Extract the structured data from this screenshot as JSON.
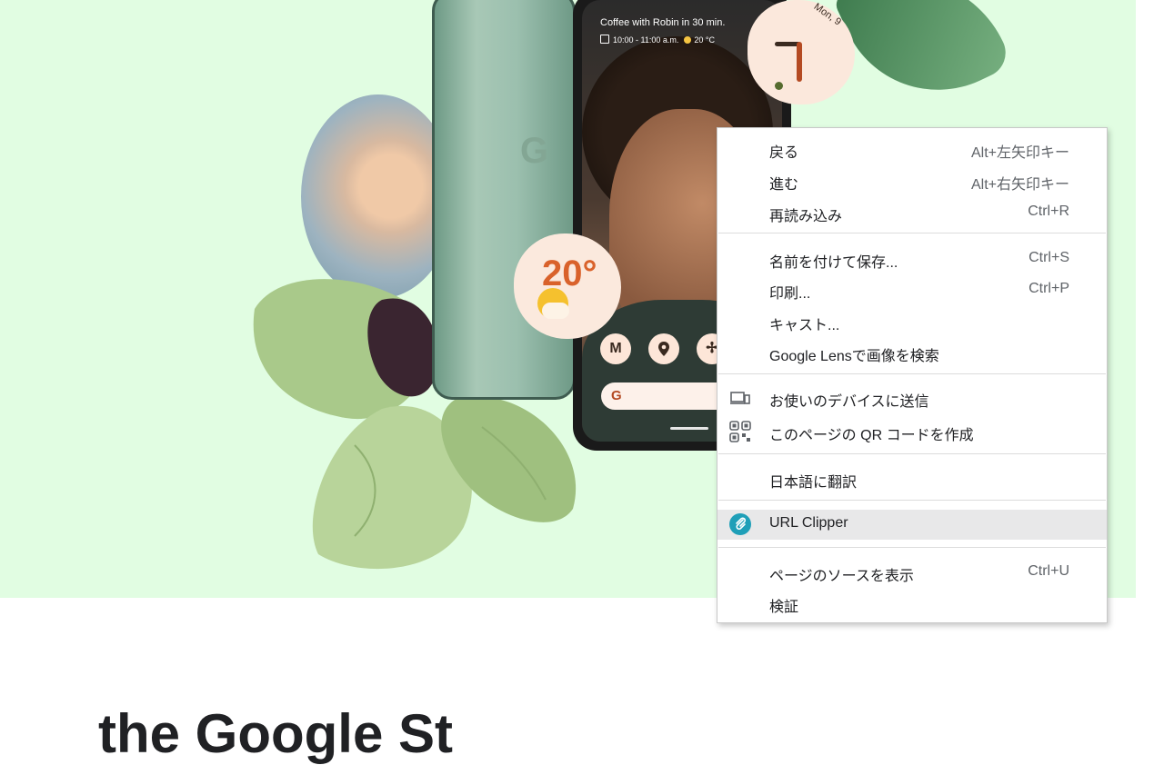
{
  "hero": {
    "background": "#e1fde2",
    "phone_screen": {
      "event_text": "Coffee with Robin in 30 min.",
      "event_time": "10:00 - 11:00 a.m.",
      "event_temp": "20 °C",
      "clock_date": "Mon, 9",
      "weather_temp": "20°",
      "app_icons": [
        "gmail-icon",
        "maps-icon",
        "pinwheel-icon"
      ]
    }
  },
  "page": {
    "heading_partial": "the Google St"
  },
  "context_menu": {
    "items": [
      {
        "label": "戻る",
        "shortcut": "Alt+左矢印キー"
      },
      {
        "label": "進む",
        "shortcut": "Alt+右矢印キー"
      },
      {
        "label": "再読み込み",
        "shortcut": "Ctrl+R"
      },
      {
        "label": "名前を付けて保存...",
        "shortcut": "Ctrl+S"
      },
      {
        "label": "印刷...",
        "shortcut": "Ctrl+P"
      },
      {
        "label": "キャスト..."
      },
      {
        "label": "Google Lensで画像を検索"
      },
      {
        "label": "お使いのデバイスに送信",
        "icon": "send-to-device-icon"
      },
      {
        "label": "このページの QR コードを作成",
        "icon": "qr-code-icon"
      },
      {
        "label": "日本語に翻訳"
      },
      {
        "label": "URL Clipper",
        "icon": "paperclip-icon",
        "highlighted": true
      },
      {
        "label": "ページのソースを表示",
        "shortcut": "Ctrl+U"
      },
      {
        "label": "検証"
      }
    ]
  }
}
